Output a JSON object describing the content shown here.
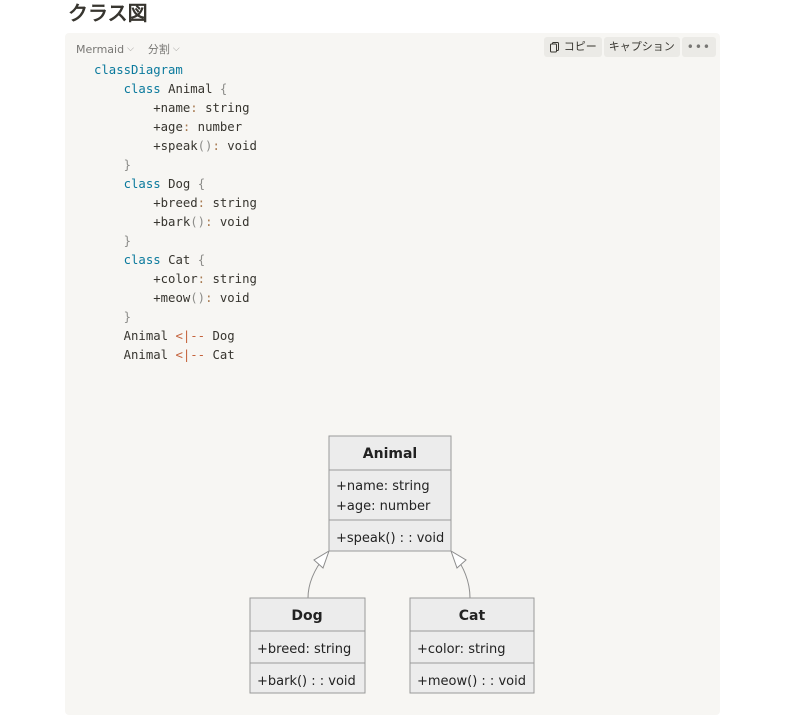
{
  "page": {
    "title": "クラス図"
  },
  "toolbar": {
    "language": "Mermaid",
    "view_mode": "分割",
    "copy_label": "コピー",
    "caption_label": "キャプション",
    "more_label": "•••"
  },
  "code": {
    "line1": "classDiagram",
    "animal_kw": "class",
    "animal_name": "Animal",
    "animal_f1_name": "+name",
    "animal_f1_type": "string",
    "animal_f2_name": "+age",
    "animal_f2_type": "number",
    "animal_m1_name": "+speak",
    "animal_m1_type": "void",
    "dog_kw": "class",
    "dog_name": "Dog",
    "dog_f1_name": "+breed",
    "dog_f1_type": "string",
    "dog_m1_name": "+bark",
    "dog_m1_type": "void",
    "cat_kw": "class",
    "cat_name": "Cat",
    "cat_f1_name": "+color",
    "cat_f1_type": "string",
    "cat_m1_name": "+meow",
    "cat_m1_type": "void",
    "rel1_from": "Animal",
    "rel1_arrow": "<|--",
    "rel1_to": "Dog",
    "rel2_from": "Animal",
    "rel2_arrow": "<|--",
    "rel2_to": "Cat"
  },
  "diagram": {
    "animal": {
      "title": "Animal",
      "attr1": "+name: string",
      "attr2": "+age: number",
      "method1": "+speak() : : void"
    },
    "dog": {
      "title": "Dog",
      "attr1": "+breed: string",
      "method1": "+bark() : : void"
    },
    "cat": {
      "title": "Cat",
      "attr1": "+color: string",
      "method1": "+meow() : : void"
    }
  },
  "colors": {
    "keyword": "#0b7a9d",
    "punctuation": "#a87b52",
    "arrow": "#c4623b",
    "box_fill": "#ececec",
    "box_stroke": "#9a9a9a"
  }
}
